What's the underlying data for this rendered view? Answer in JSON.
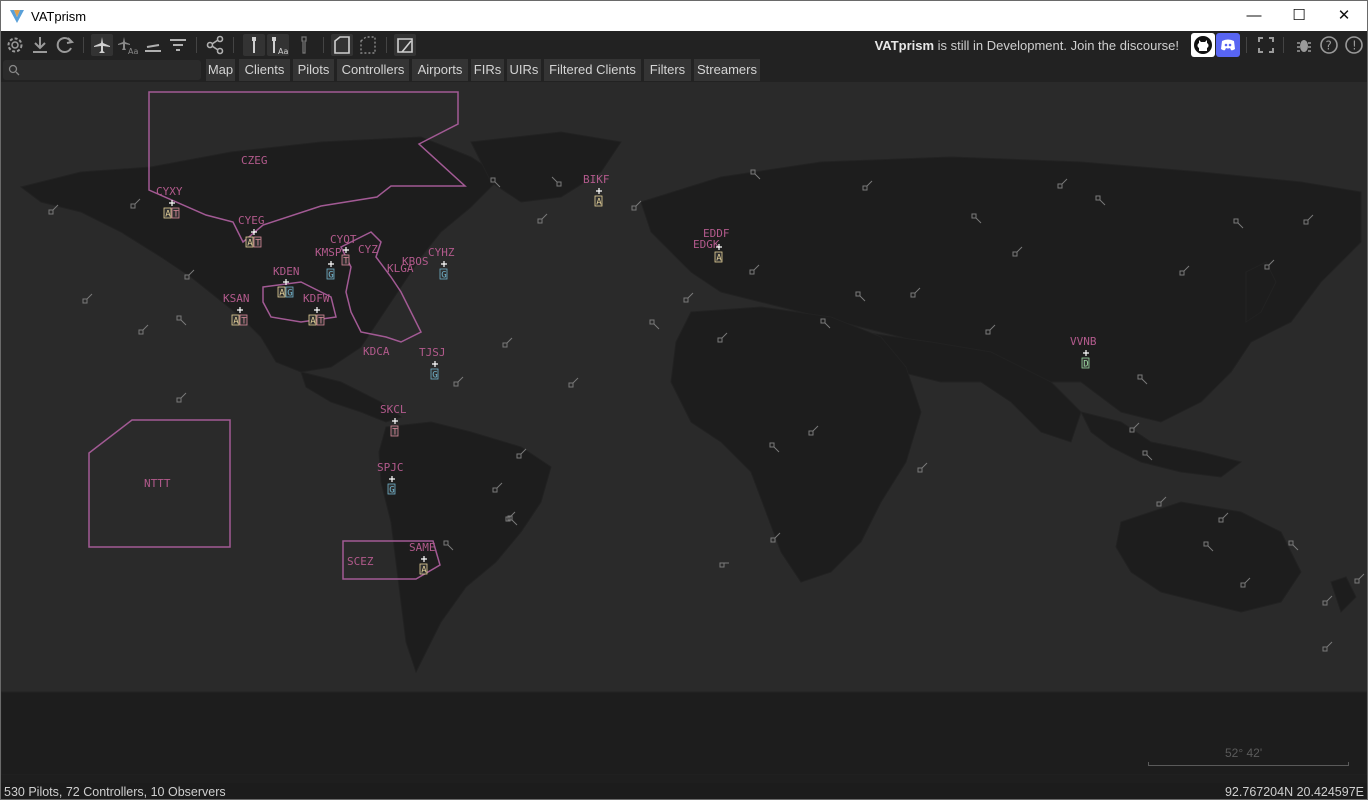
{
  "window": {
    "title": "VATprism",
    "minimize_glyph": "—",
    "maximize_glyph": "☐",
    "close_glyph": "✕"
  },
  "toolbar": {
    "icons": [
      "settings-icon",
      "download-icon",
      "refresh-icon",
      "aircraft-icon",
      "aircraft-label-icon",
      "runway-icon",
      "filter-icon",
      "share-icon",
      "airport-icon",
      "airport-label-icon",
      "tower-icon",
      "fir-icon",
      "uir-icon",
      "map-layer-icon"
    ],
    "notice_brand": "VATprism",
    "notice_text": " is still in Development. Join the discourse!",
    "right_icons": [
      "github-icon",
      "discord-icon",
      "fullscreen-icon",
      "bug-icon",
      "help-icon",
      "info-icon"
    ]
  },
  "search": {
    "placeholder": "",
    "value": ""
  },
  "tabs": [
    "Map",
    "Clients",
    "Pilots",
    "Controllers",
    "Airports",
    "FIRs",
    "UIRs",
    "Filtered Clients",
    "Filters",
    "Streamers"
  ],
  "map": {
    "fir_labels": [
      "CZEG",
      "NTTT",
      "SCEZ"
    ],
    "airport_labels": [
      "CYXY",
      "CYEG",
      "CYQT",
      "CYZ",
      "KMSP",
      "CYHZ",
      "KDEN",
      "KSAN",
      "TJSJ",
      "SKCL",
      "SPJC",
      "BIKF",
      "EDDF",
      "EDGK",
      "VVNB",
      "SAME",
      "KDFW",
      "KDCA",
      "KLGA",
      "KBOS"
    ],
    "controller_badges": {
      "CYXY": "AT",
      "CYEG": "AT",
      "CYQT": "T",
      "KMSP": "G",
      "CYHZ": "G",
      "KDEN": "AG",
      "KSAN": "AT",
      "KDFW": "AT",
      "TJSJ": "G",
      "SKCL": "T",
      "SPJC": "G",
      "BIKF": "A",
      "EDDF": "A",
      "VVNB": "D",
      "SAME": "A"
    },
    "scale_label": "52° 42'",
    "colors": {
      "ocean": "#2a2a2a",
      "land": "#1c1c1c",
      "fir_outline": "#a25a94",
      "fir_label": "#b25a8c",
      "badge_atis": "#e6d39a",
      "badge_tower": "#d88a9a",
      "badge_ground": "#6fb0c8",
      "badge_delivery": "#9ad6a0"
    }
  },
  "status": {
    "summary": "530 Pilots, 72 Controllers, 10 Observers",
    "coordinates": "92.767204N 20.424597E"
  }
}
